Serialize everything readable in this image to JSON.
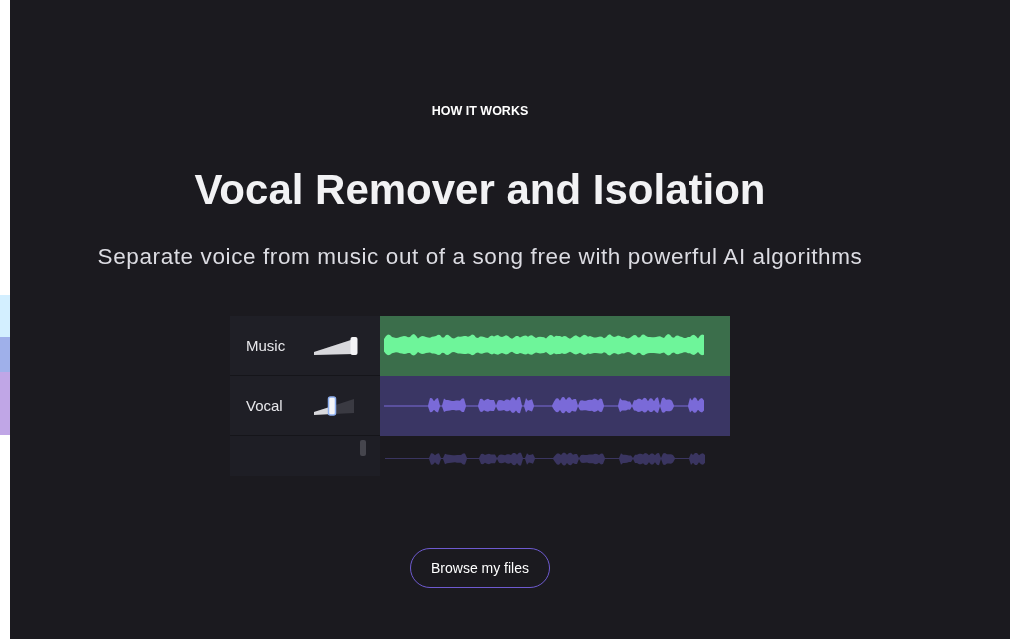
{
  "eyebrow": "HOW IT WORKS",
  "title": "Vocal Remover and Isolation",
  "subtitle": "Separate voice from music out of a song free with powerful AI algorithms",
  "tracks": [
    {
      "label": "Music",
      "level": 1,
      "color": "#6ef59a",
      "kind": "dense"
    },
    {
      "label": "Vocal",
      "level": 0.45,
      "color": "#7a6ad8",
      "kind": "sparse"
    }
  ],
  "button": "Browse my files"
}
